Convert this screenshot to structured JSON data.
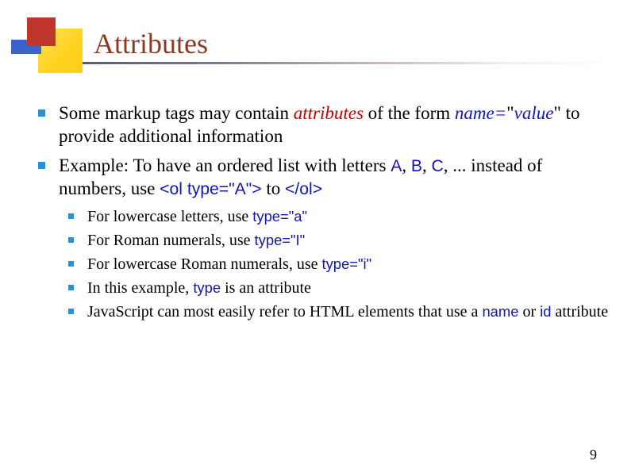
{
  "title": "Attributes",
  "bullets": {
    "b1": {
      "pre": "Some markup tags may contain ",
      "attr_word": "attributes",
      "mid": " of the form ",
      "name_word": "name",
      "eq": "=",
      "q1": "\"",
      "value_word": "value",
      "q2": "\"",
      "post": " to provide additional information"
    },
    "b2": {
      "pre": "Example: To have an ordered list with letters ",
      "a": "A",
      "c1": ", ",
      "b": "B",
      "c2": ", ",
      "c": "C",
      "mid": ", ... instead of numbers, use ",
      "open_tag": "<ol type=\"A\">",
      "to": " to ",
      "close_tag": "</ol>"
    },
    "s1": {
      "pre": "For lowercase letters, use ",
      "code": "type=\"a\""
    },
    "s2": {
      "pre": "For Roman numerals, use ",
      "code": "type=\"I\""
    },
    "s3": {
      "pre": "For lowercase Roman numerals, use ",
      "code": "type=\"i\""
    },
    "s4": {
      "pre": "In this example, ",
      "code": "type",
      "post": " is an attribute"
    },
    "s5": {
      "pre": "JavaScript can most easily refer to HTML elements that use a ",
      "name_w": "name",
      "or": " or ",
      "id_w": "id",
      "post": " attribute"
    }
  },
  "page_number": "9"
}
